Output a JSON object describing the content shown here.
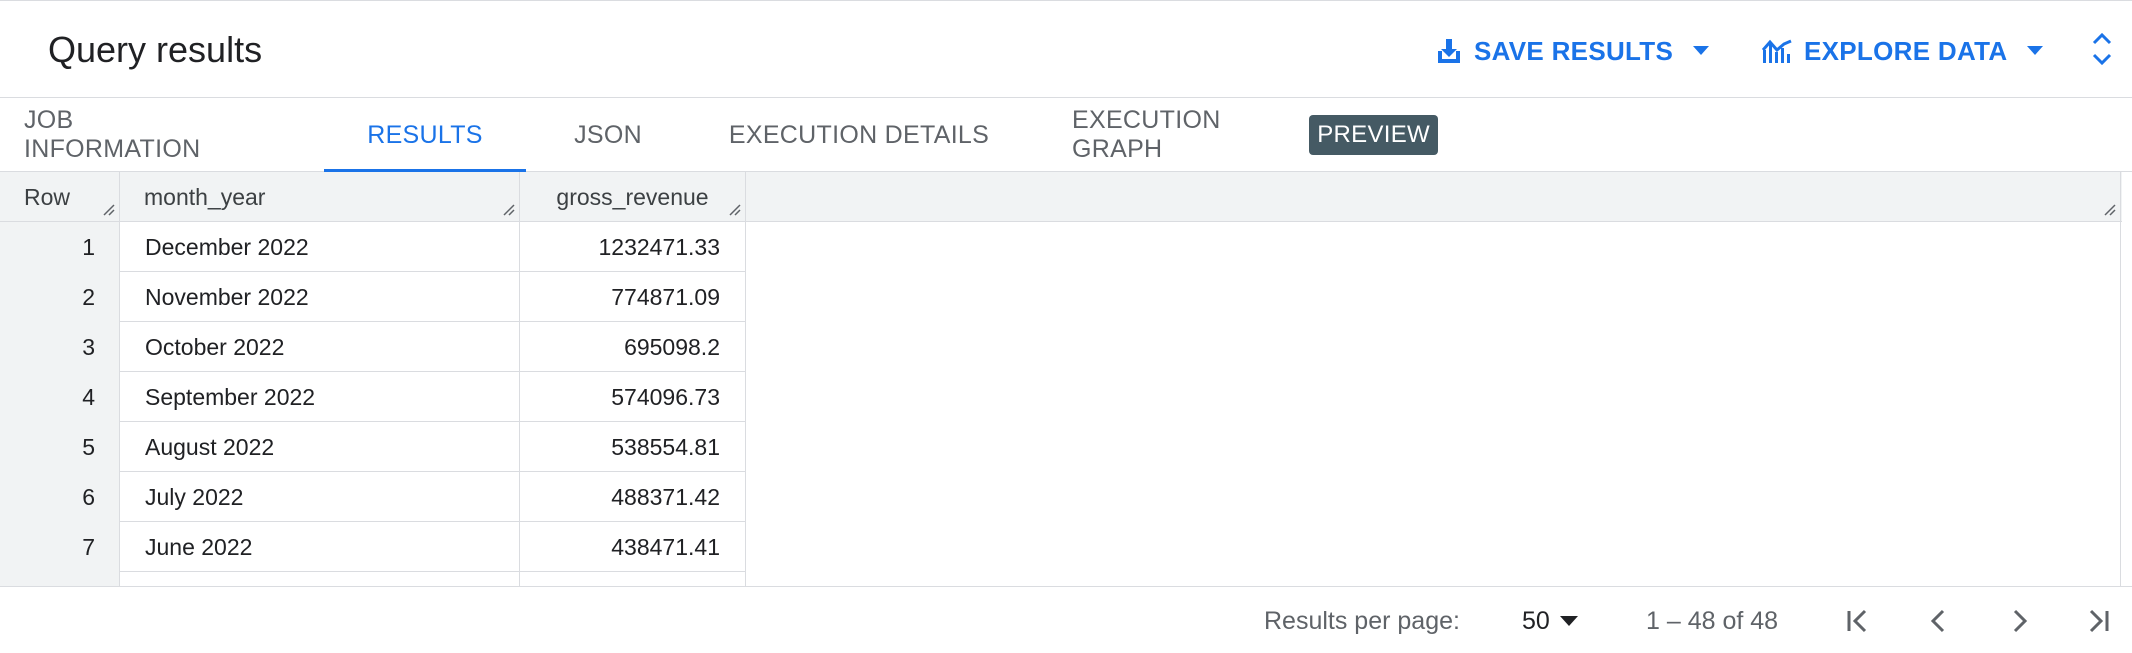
{
  "header": {
    "title": "Query results",
    "save_results": {
      "label": "SAVE RESULTS",
      "icon": "download-icon"
    },
    "explore_data": {
      "label": "EXPLORE DATA",
      "icon": "chart-icon"
    },
    "expand_icon": "unfold-more-icon",
    "accent_color": "#1a73e8"
  },
  "tabs": [
    {
      "label": "JOB INFORMATION",
      "active": false
    },
    {
      "label": "RESULTS",
      "active": true
    },
    {
      "label": "JSON",
      "active": false
    },
    {
      "label": "EXECUTION DETAILS",
      "active": false
    },
    {
      "label": "EXECUTION GRAPH",
      "active": false,
      "badge": "PREVIEW"
    }
  ],
  "table": {
    "columns": [
      "Row",
      "month_year",
      "gross_revenue"
    ],
    "rows": [
      {
        "row": "1",
        "month_year": "December 2022",
        "gross_revenue": "1232471.33"
      },
      {
        "row": "2",
        "month_year": "November 2022",
        "gross_revenue": "774871.09"
      },
      {
        "row": "3",
        "month_year": "October 2022",
        "gross_revenue": "695098.2"
      },
      {
        "row": "4",
        "month_year": "September 2022",
        "gross_revenue": "574096.73"
      },
      {
        "row": "5",
        "month_year": "August 2022",
        "gross_revenue": "538554.81"
      },
      {
        "row": "6",
        "month_year": "July 2022",
        "gross_revenue": "488371.42"
      },
      {
        "row": "7",
        "month_year": "June 2022",
        "gross_revenue": "438471.41"
      }
    ]
  },
  "footer": {
    "results_per_page_label": "Results per page:",
    "results_per_page_value": "50",
    "range_text": "1 – 48 of 48"
  }
}
